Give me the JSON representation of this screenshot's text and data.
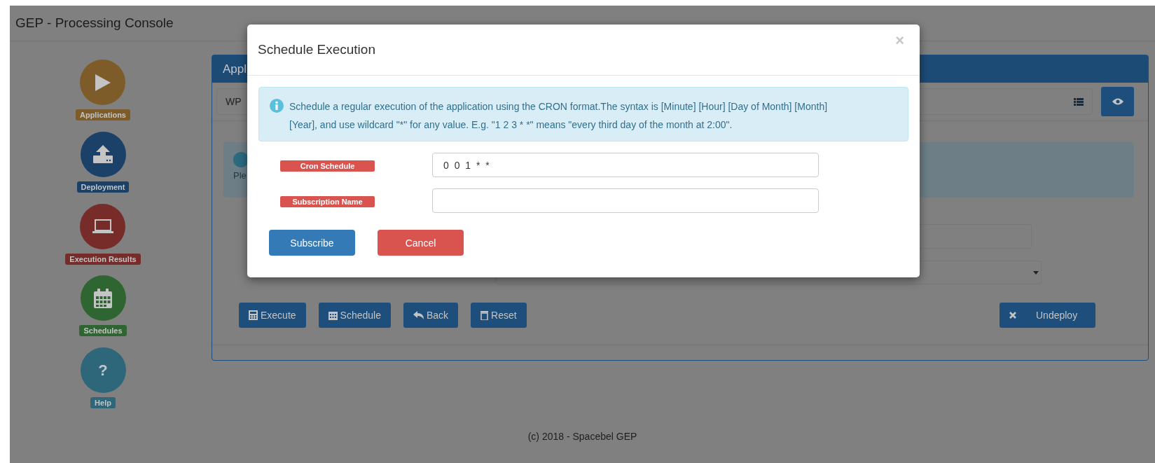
{
  "app_title": "GEP - Processing Console",
  "sidebar": {
    "items": [
      {
        "label": "Applications",
        "kind": "play",
        "color": "#7d5c2a"
      },
      {
        "label": "Deployment",
        "kind": "upload",
        "color": "#1b4168"
      },
      {
        "label": "Execution Results",
        "kind": "laptop",
        "color": "#772c29"
      },
      {
        "label": "Schedules",
        "kind": "calendar",
        "color": "#2f6531"
      },
      {
        "label": "Help",
        "kind": "glyph",
        "glyph": "?",
        "color": "#2e677a"
      }
    ]
  },
  "panel": {
    "header": "Appl",
    "selector_value": "WP",
    "alert_text": "Ple",
    "actions": [
      {
        "label": "Execute",
        "kind": "calculator"
      },
      {
        "label": "Schedule",
        "kind": "calendar"
      },
      {
        "label": "Back",
        "kind": "reply"
      },
      {
        "label": "Reset",
        "kind": "trash"
      }
    ],
    "undeploy": {
      "label": "Undeploy",
      "kind": "times"
    }
  },
  "modal": {
    "title": "Schedule Execution",
    "close": "×",
    "info": "Schedule a regular execution of the application using the CRON format.The syntax is [Minute] [Hour] [Day of Month] [Month] [Year], and use wildcard \"*\" for any value. E.g. \"1 2 3 * *\" means \"every third day of the month at 2:00\".",
    "fields": [
      {
        "label": "Cron Schedule",
        "value": "0 0 1 * *"
      },
      {
        "label": "Subscription Name"
      }
    ],
    "buttons": [
      {
        "label": "Subscribe",
        "kind": "primary"
      },
      {
        "label": "Cancel",
        "kind": "danger"
      }
    ]
  },
  "footer": "(c) 2018 - Spacebel GEP"
}
